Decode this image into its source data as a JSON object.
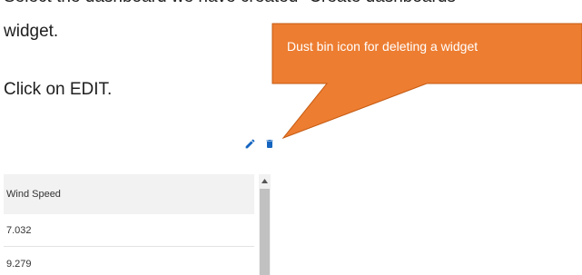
{
  "document": {
    "line1": "Select the dashboard we have created \"Create dashboards\"",
    "line2": "widget.",
    "line3": "Click on EDIT."
  },
  "callout": {
    "text": "Dust bin icon for deleting a widget",
    "color": "#ed7d31"
  },
  "widget_actions": {
    "edit_icon": "pencil-icon",
    "delete_icon": "trash-icon",
    "icon_color": "#1565c0"
  },
  "table": {
    "header": "Wind Speed",
    "rows": [
      "7.032",
      "9.279"
    ],
    "scroll_up_icon": "caret-up-icon"
  }
}
